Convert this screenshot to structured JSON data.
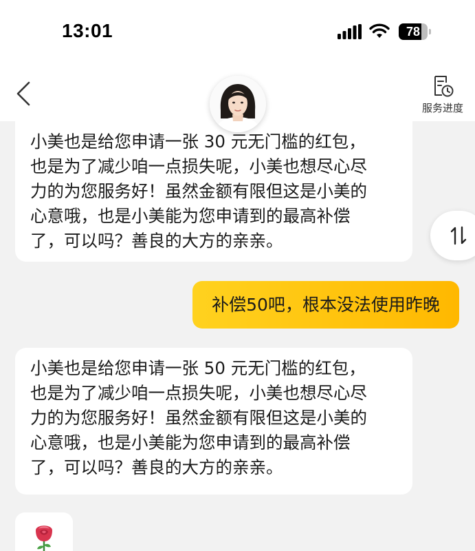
{
  "status_bar": {
    "time": "13:01",
    "battery_level": "78",
    "battery_fraction": 0.78,
    "icons": [
      "signal-icon",
      "wifi-icon",
      "battery-icon"
    ]
  },
  "nav": {
    "back_icon": "chevron-left-icon",
    "avatar": "agent-avatar",
    "service_progress_icon": "document-clock-icon",
    "service_progress_label": "服务进度"
  },
  "chat": {
    "messages": [
      {
        "side": "left",
        "lines": [
          "小美也是给您申请一张 30   元无门槛的红包，",
          "也是为了减少咱一点损失呢，小美也想尽心尽",
          "力的为您服务好！虽然金额有限但这是小美的",
          "心意哦，也是小美能为您申请到的最高补偿",
          "了，可以吗？善良的大方的亲亲。"
        ]
      },
      {
        "side": "right",
        "text": "补偿50吧，根本没法使用昨晚"
      },
      {
        "side": "left",
        "lines": [
          "小美也是给您申请一张   50 元无门槛的红包，",
          "也是为了减少咱一点损失呢，小美也想尽心尽",
          "力的为您服务好！虽然金额有限但这是小美的",
          "心意哦，也是小美能为您申请到的最高补偿",
          "了，可以吗？善良的大方的亲亲。"
        ]
      },
      {
        "side": "left",
        "sticker": "rose-icon"
      }
    ],
    "scroll_toggle_icon": "sort-arrows-icon"
  },
  "colors": {
    "background": "#f2f2f2",
    "bubble_left": "#ffffff",
    "bubble_right_start": "#ffd21f",
    "bubble_right_end": "#ffb800",
    "text": "#1a1a1a"
  }
}
